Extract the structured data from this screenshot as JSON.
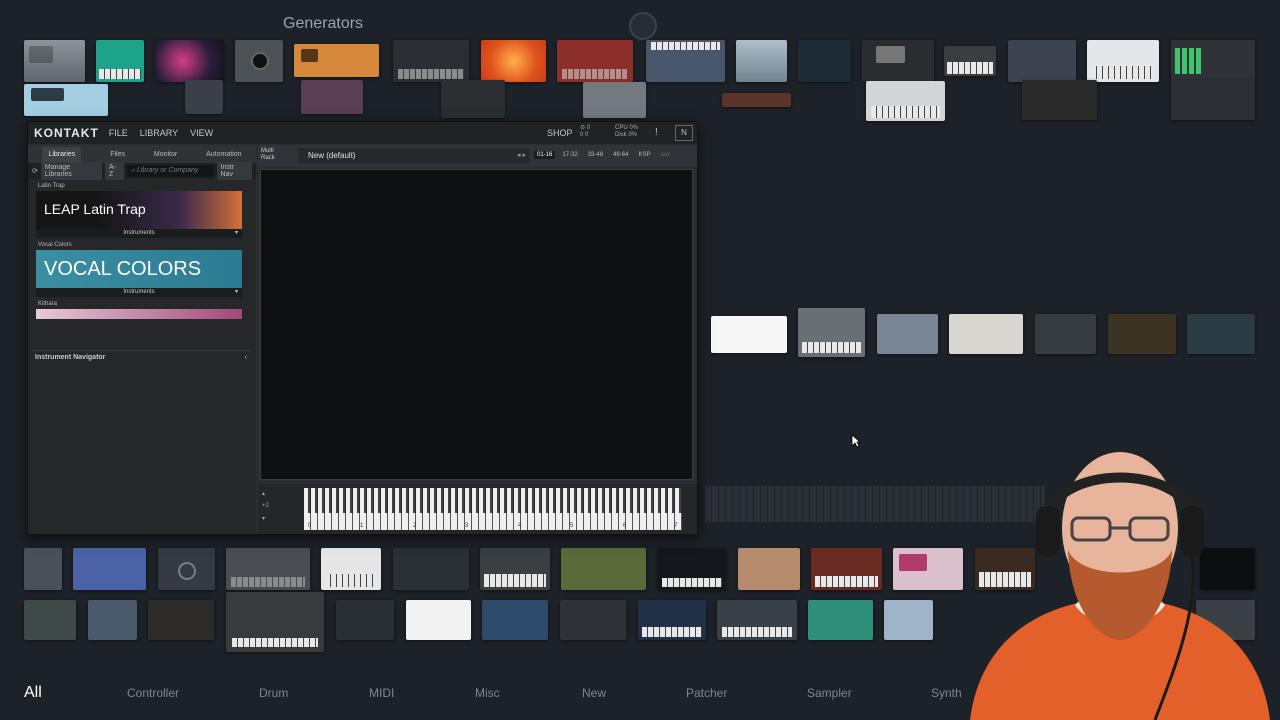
{
  "header": {
    "section_title": "Generators"
  },
  "kontakt": {
    "logo": "KONTAKT",
    "menu": [
      "FILE",
      "LIBRARY",
      "VIEW"
    ],
    "shop": "SHOP",
    "meter_line1": "⊘ 0",
    "meter_line2": "0 0",
    "cpu": "CPU 0%",
    "disk": "Disk 0%",
    "warning": "!",
    "ni_logo": "N",
    "side_tabs": [
      "Libraries",
      "Files",
      "Monitor",
      "Automation"
    ],
    "tools": {
      "manage": "Manage Libraries",
      "sort": "A-Z",
      "search_placeholder": "Library or Company",
      "instr": "Instr Nav"
    },
    "libraries": [
      {
        "name": "Latin Trap",
        "banner": "LEAP Latin Trap",
        "sub": "Instruments"
      },
      {
        "name": "Vocal Colors",
        "banner": "VOCAL COLORS",
        "sub": "Instruments"
      },
      {
        "name": "Kithara",
        "banner": "",
        "sub": ""
      }
    ],
    "instrument_navigator": "Instrument Navigator",
    "rack_label_1": "Multi",
    "rack_label_2": "Rack",
    "preset_name": "New (default)",
    "rack_tabs": [
      "01-16",
      "17-32",
      "33-48",
      "49-64",
      "KSP",
      "aux"
    ],
    "kbd_side": "+2",
    "octaves": [
      "0",
      "1",
      "2",
      "3",
      "4",
      "5",
      "6",
      "7"
    ]
  },
  "categories": [
    {
      "label": "All",
      "active": true
    },
    {
      "label": "Controller",
      "active": false
    },
    {
      "label": "Drum",
      "active": false
    },
    {
      "label": "MIDI",
      "active": false
    },
    {
      "label": "Misc",
      "active": false
    },
    {
      "label": "New",
      "active": false
    },
    {
      "label": "Patcher",
      "active": false
    },
    {
      "label": "Sampler",
      "active": false
    },
    {
      "label": "Synth",
      "active": false
    }
  ],
  "colors": {
    "background": "#1d2228",
    "kontakt_frame": "#2b2d30",
    "active_category": "#ffffff",
    "inactive_category": "#7e868e"
  }
}
